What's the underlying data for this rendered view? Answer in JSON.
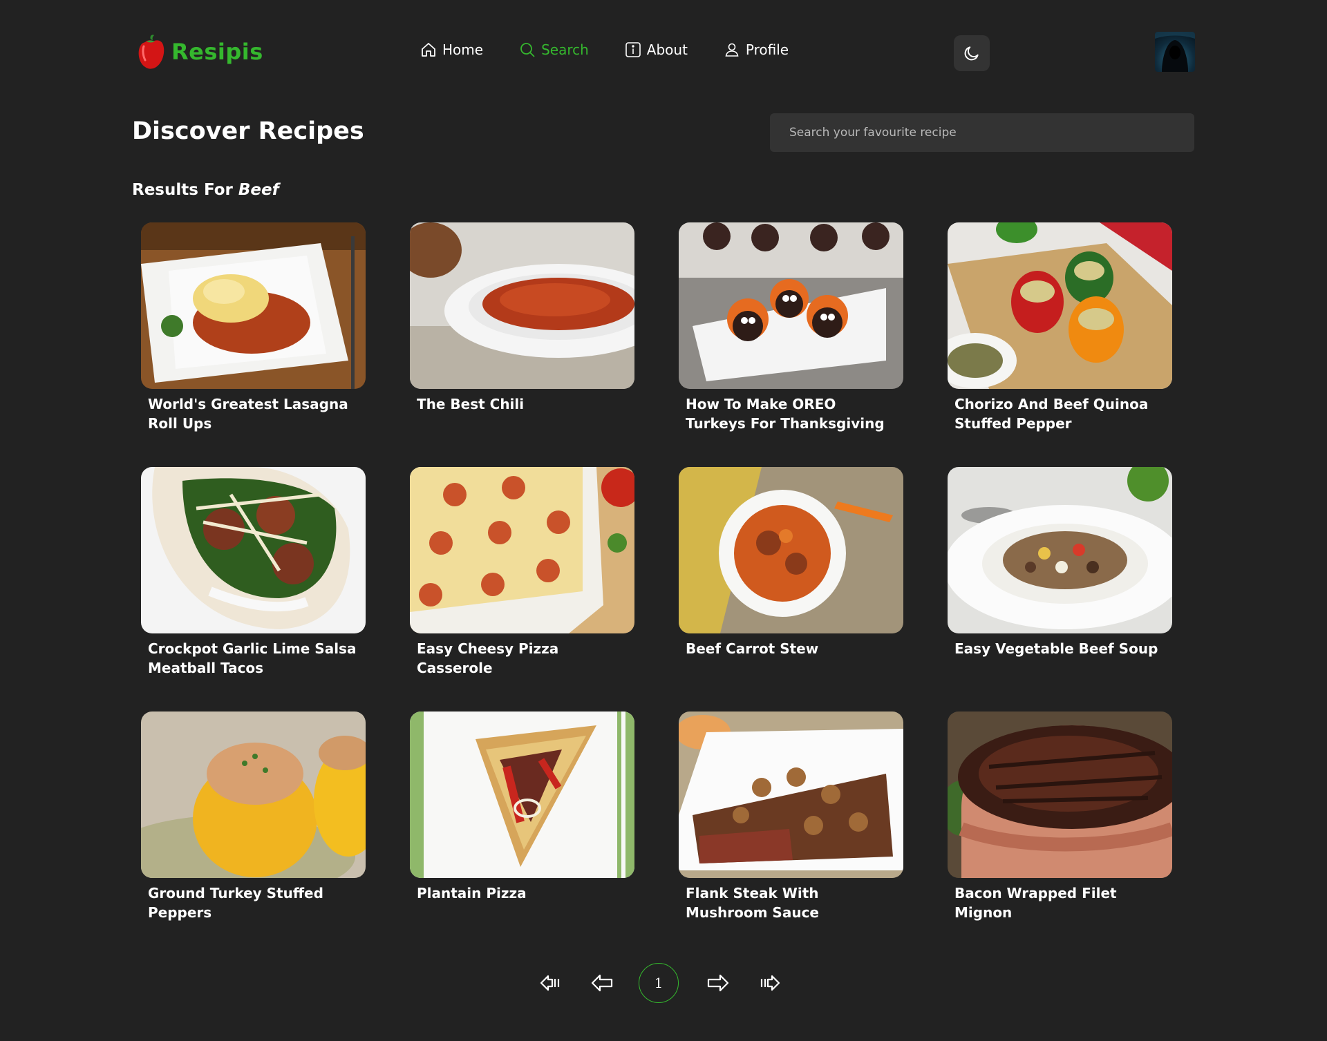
{
  "brand": {
    "name": "Resipis",
    "color": "#35b82e"
  },
  "nav": [
    {
      "label": "Home",
      "icon": "home-icon",
      "active": false
    },
    {
      "label": "Search",
      "icon": "search-icon",
      "active": true
    },
    {
      "label": "About",
      "icon": "info-icon",
      "active": false
    },
    {
      "label": "Profile",
      "icon": "user-icon",
      "active": false
    }
  ],
  "theme_toggle_icon": "moon-icon",
  "page": {
    "title": "Discover Recipes",
    "search_placeholder": "Search your favourite recipe",
    "results_prefix": "Results For",
    "results_query": "Beef"
  },
  "recipes": [
    {
      "title": "World's Greatest Lasagna Roll Ups"
    },
    {
      "title": "The Best Chili"
    },
    {
      "title": "How To Make OREO Turkeys For Thanksgiving"
    },
    {
      "title": "Chorizo And Beef Quinoa Stuffed Pepper"
    },
    {
      "title": "Crockpot Garlic Lime Salsa Meatball Tacos"
    },
    {
      "title": "Easy Cheesy Pizza Casserole"
    },
    {
      "title": "Beef Carrot Stew"
    },
    {
      "title": "Easy Vegetable Beef Soup"
    },
    {
      "title": "Ground Turkey Stuffed Peppers"
    },
    {
      "title": "Plantain Pizza"
    },
    {
      "title": "Flank Steak With Mushroom Sauce"
    },
    {
      "title": "Bacon Wrapped Filet Mignon"
    }
  ],
  "pagination": {
    "current_page": "1"
  }
}
